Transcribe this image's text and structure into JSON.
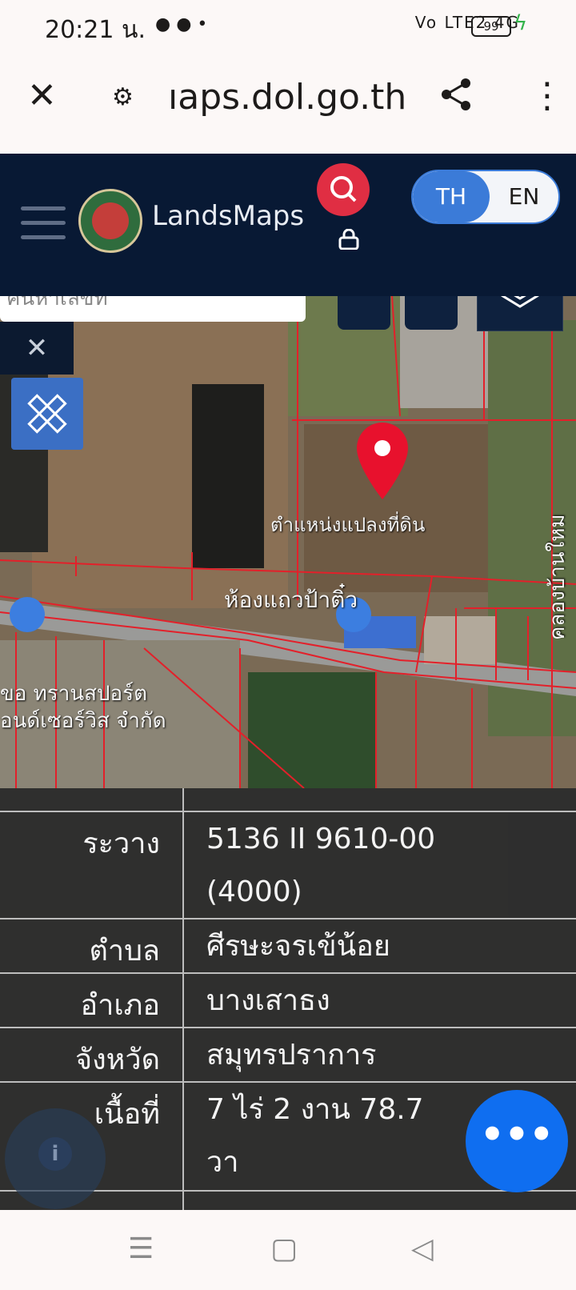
{
  "status_bar": {
    "time": "20:21 น.",
    "indicators": "Vo LTE2 4G",
    "battery": "99"
  },
  "browser": {
    "url": "ıaps.dol.go.th"
  },
  "header": {
    "brand": "LandsMaps",
    "lang_th": "TH",
    "lang_en": "EN"
  },
  "map": {
    "search_placeholder": "ค้นหาเลขที่",
    "pin_label": "ตำแหน่งแปลงที่ดิน",
    "place_label": "ห้องแถวป้าติ๋ว",
    "shop_label_1": "ขอ ทรานสปอร์ต",
    "shop_label_2": "อนด์เซอร์วิส จำกัด",
    "road_label": "คลองบ้านใหม"
  },
  "panel": {
    "rows": [
      {
        "label": "ระวาง",
        "value_1": "5136 II 9610-00",
        "value_2": "(4000)"
      },
      {
        "label": "ตำบล",
        "value_1": "ศีรษะจรเข้น้อย"
      },
      {
        "label": "อำเภอ",
        "value_1": "บางเสาธง"
      },
      {
        "label": "จังหวัด",
        "value_1": "สมุทรปราการ"
      },
      {
        "label": "เนื้อที่",
        "value_1": "7 ไร่ 2 งาน 78.7",
        "value_2": "วา"
      }
    ]
  },
  "fab_label": "•••"
}
